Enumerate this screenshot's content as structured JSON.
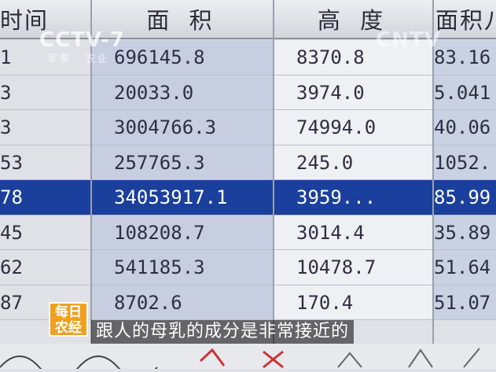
{
  "table": {
    "headers": [
      "时间",
      "面 积",
      "高 度",
      "面积八"
    ],
    "rows": [
      {
        "c0": "1",
        "c1": "696145.8",
        "c2": "8370.8",
        "c3": "83.16"
      },
      {
        "c0": "3",
        "c1": "20033.0",
        "c2": "3974.0",
        "c3": "5.041"
      },
      {
        "c0": "3",
        "c1": "3004766.3",
        "c2": "74994.0",
        "c3": "40.06"
      },
      {
        "c0": "53",
        "c1": "257765.3",
        "c2": "245.0",
        "c3": "1052."
      },
      {
        "c0": "78",
        "c1": "34053917.1",
        "c2": "3959...",
        "c3": "85.99"
      },
      {
        "c0": "45",
        "c1": "108208.7",
        "c2": "3014.4",
        "c3": "35.89"
      },
      {
        "c0": "62",
        "c1": "541185.3",
        "c2": "10478.7",
        "c3": "51.64"
      },
      {
        "c0": "87",
        "c1": "8702.6",
        "c2": "170.4",
        "c3": "51.07"
      }
    ],
    "selected_row": 4
  },
  "watermark": {
    "logo": "CCTV-7",
    "logo_sub": "军事 · 农业",
    "logo_right": "CNTV"
  },
  "badge": {
    "line1": "每日",
    "line2": "农经"
  },
  "subtitle": "跟人的母乳的成分是非常接近的",
  "colors": {
    "selected_row": "#1b3f9c",
    "badge": "#f0a020"
  }
}
